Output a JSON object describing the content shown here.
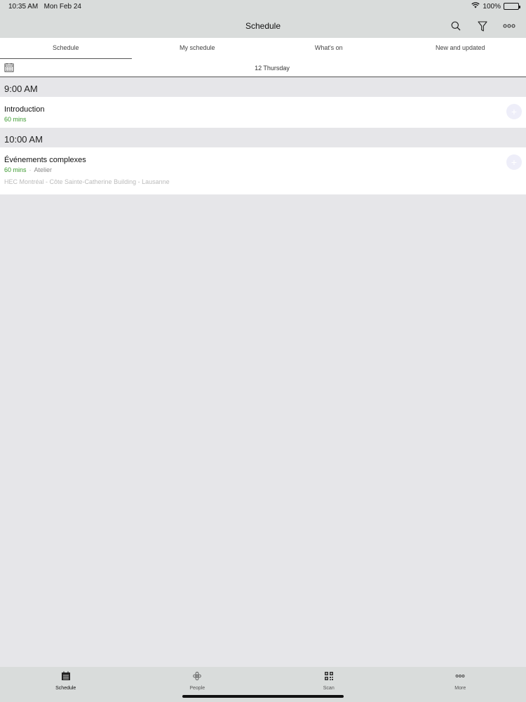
{
  "status": {
    "time": "10:35 AM",
    "date": "Mon Feb 24",
    "battery": "100%",
    "battery_level": 1.0
  },
  "header": {
    "title": "Schedule",
    "actions": [
      {
        "icon": "search-icon"
      },
      {
        "icon": "filter-icon"
      },
      {
        "icon": "more-icon"
      }
    ]
  },
  "tabs": [
    {
      "label": "Schedule",
      "active": true
    },
    {
      "label": "My schedule",
      "active": false
    },
    {
      "label": "What's on",
      "active": false
    },
    {
      "label": "New and updated",
      "active": false
    }
  ],
  "date_bar": {
    "icon": "calendar-icon",
    "label": "12 Thursday"
  },
  "groups": [
    {
      "time": "9:00 AM",
      "sessions": [
        {
          "title": "Introduction",
          "duration": "60 mins",
          "type": "",
          "location": ""
        }
      ]
    },
    {
      "time": "10:00 AM",
      "sessions": [
        {
          "title": "Événements complexes",
          "duration": "60 mins",
          "type": "Atelier",
          "location": "HEC Montréal - Côte Sainte-Catherine Building - Lausanne"
        }
      ]
    }
  ],
  "bottom_tabs": [
    {
      "label": "Schedule",
      "icon": "schedule-icon",
      "active": true
    },
    {
      "label": "People",
      "icon": "people-icon",
      "active": false
    },
    {
      "label": "Scan",
      "icon": "qr-code-icon",
      "active": false
    },
    {
      "label": "More",
      "icon": "more-icon",
      "active": false
    }
  ]
}
